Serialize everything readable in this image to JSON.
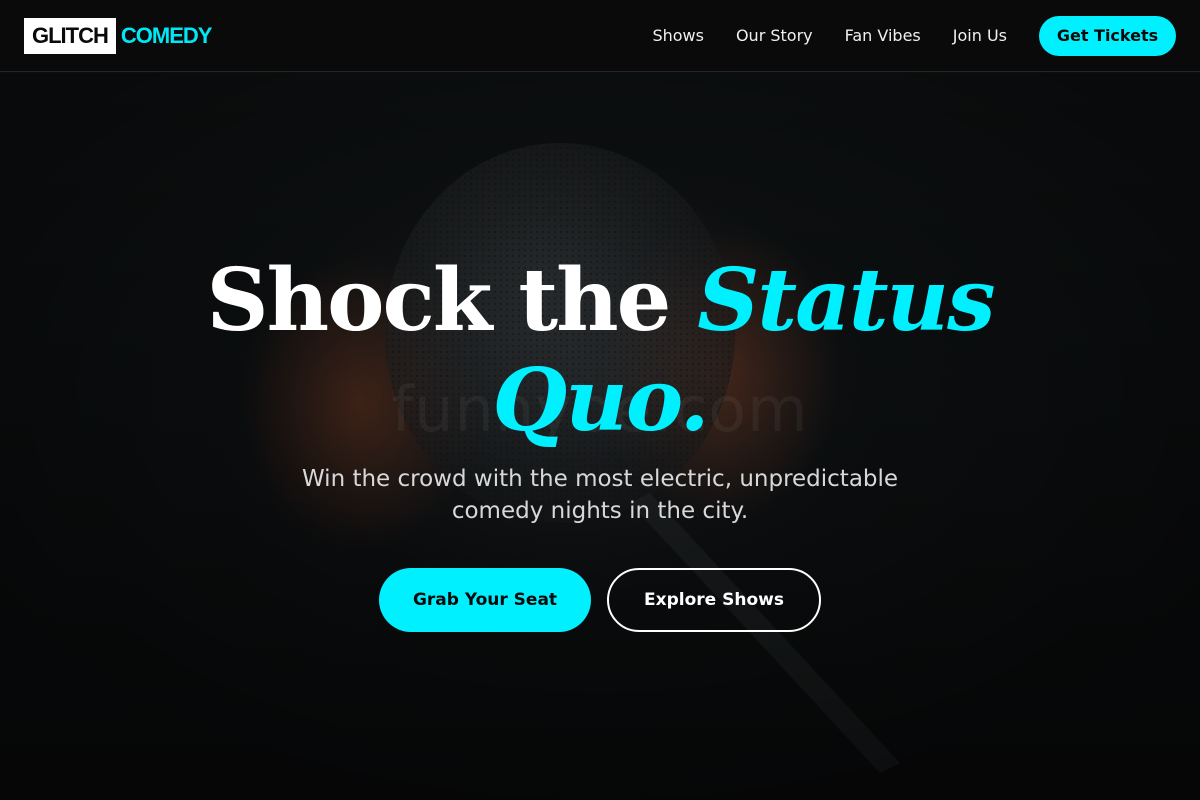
{
  "brand": {
    "logo_box": "GLITCH",
    "logo_accent": "COMEDY"
  },
  "nav": {
    "links": [
      "Shows",
      "Our Story",
      "Fan Vibes",
      "Join Us"
    ],
    "cta": "Get Tickets"
  },
  "hero": {
    "watermark": "funnybe.com",
    "headline_white": "Shock the ",
    "headline_accent_1": "Status",
    "headline_accent_2": "Quo.",
    "subtitle": "Win the crowd with the most electric, unpredictable comedy nights in the city.",
    "primary_button": "Grab Your Seat",
    "secondary_button": "Explore Shows"
  },
  "colors": {
    "accent": "#00f0ff",
    "nav_background": "#0a0a0a",
    "hero_background": "#101315"
  }
}
